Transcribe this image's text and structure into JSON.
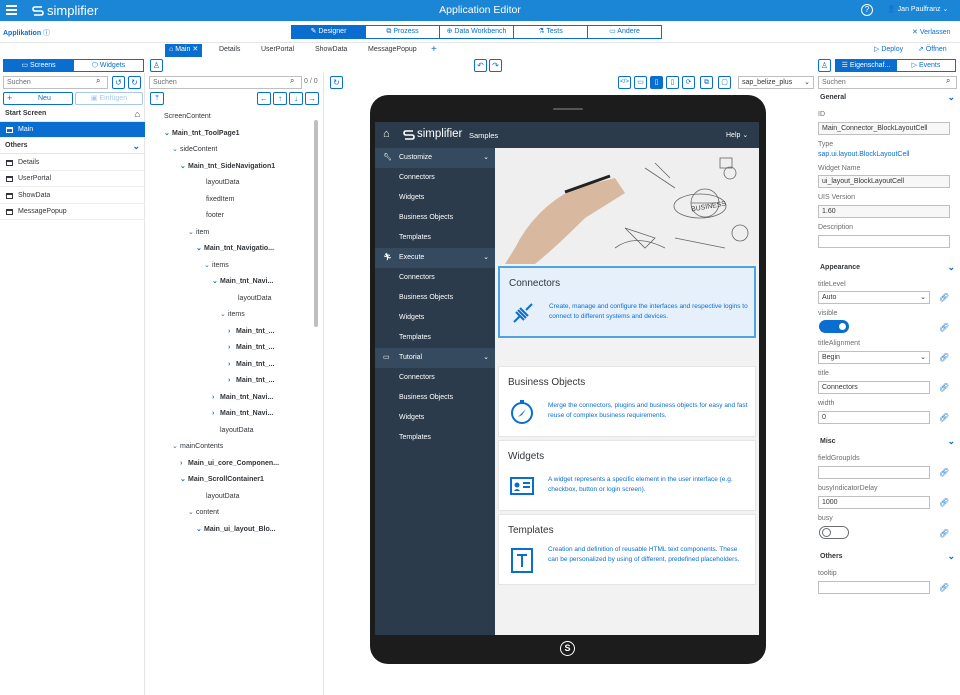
{
  "topbar": {
    "brand": "simplifier",
    "title": "Application Editor",
    "help": "?",
    "user": "Jan Paulfranz"
  },
  "bar2": {
    "app_label": "Applikation",
    "modes": [
      "Designer",
      "Prozess",
      "Data Workbench",
      "Tests",
      "Andere"
    ],
    "leave": "Verlassen"
  },
  "tabs": {
    "items": [
      "Main",
      "Details",
      "UserPortal",
      "ShowData",
      "MessagePopup"
    ],
    "add": "+",
    "deploy": "Deploy",
    "open": "Öffnen"
  },
  "left": {
    "seg_screens": "Screens",
    "seg_widgets": "Widgets",
    "search_placeholder": "Suchen",
    "new_label": "Neu",
    "paste_label": "Einfügen",
    "start_header": "Start Screen",
    "start_items": [
      "Main"
    ],
    "others_header": "Others",
    "others_items": [
      "Details",
      "UserPortal",
      "ShowData",
      "MessagePopup"
    ]
  },
  "tree": {
    "search_placeholder": "Suchen",
    "count": "0 / 0",
    "nodes": [
      {
        "label": "ScreenContent",
        "chev": ""
      },
      {
        "label": "Main_tnt_ToolPage1",
        "chev": "⌄",
        "bold": true
      },
      {
        "label": "sideContent",
        "chev": "⌄"
      },
      {
        "label": "Main_tnt_SideNavigation1",
        "chev": "⌄",
        "bold": true
      },
      {
        "label": "layoutData",
        "chev": ""
      },
      {
        "label": "fixedItem",
        "chev": ""
      },
      {
        "label": "footer",
        "chev": ""
      },
      {
        "label": "item",
        "chev": "⌄"
      },
      {
        "label": "Main_tnt_Navigatio...",
        "chev": "⌄",
        "bold": true
      },
      {
        "label": "items",
        "chev": "⌄"
      },
      {
        "label": "Main_tnt_Navi...",
        "chev": "⌄",
        "bold": true
      },
      {
        "label": "layoutData",
        "chev": ""
      },
      {
        "label": "items",
        "chev": "⌄"
      },
      {
        "label": "Main_tnt_...",
        "chev": "›",
        "bold": true
      },
      {
        "label": "Main_tnt_...",
        "chev": "›",
        "bold": true
      },
      {
        "label": "Main_tnt_...",
        "chev": "›",
        "bold": true
      },
      {
        "label": "Main_tnt_...",
        "chev": "›",
        "bold": true
      },
      {
        "label": "Main_tnt_Navi...",
        "chev": "›",
        "bold": true
      },
      {
        "label": "Main_tnt_Navi...",
        "chev": "›",
        "bold": true
      },
      {
        "label": "layoutData",
        "chev": ""
      },
      {
        "label": "mainContents",
        "chev": "⌄"
      },
      {
        "label": "Main_ui_core_Componen...",
        "chev": "›",
        "bold": true
      },
      {
        "label": "Main_ScrollContainer1",
        "chev": "⌄",
        "bold": true
      },
      {
        "label": "layoutData",
        "chev": ""
      },
      {
        "label": "content",
        "chev": "⌄"
      },
      {
        "label": "Main_ui_layout_Blo...",
        "chev": "⌄",
        "bold": true
      }
    ]
  },
  "canvas": {
    "theme": "sap_belize_plus"
  },
  "app": {
    "brand": "simplifier",
    "section": "Samples",
    "help": "Help",
    "nav": [
      {
        "group": "Customize",
        "items": [
          "Connectors",
          "Widgets",
          "Business Objects",
          "Templates"
        ]
      },
      {
        "group": "Execute",
        "items": [
          "Connectors",
          "Business Objects",
          "Widgets",
          "Templates"
        ]
      },
      {
        "group": "Tutorial",
        "items": [
          "Connectors",
          "Business Objects",
          "Widgets",
          "Templates"
        ]
      }
    ],
    "cards": [
      {
        "title": "Connectors",
        "desc": "Create, manage and configure the interfaces and respective logins to connect to different systems and devices."
      },
      {
        "title": "Business Objects",
        "desc": "Merge the connectors, plugins and business objects for easy and fast reuse of complex business requirements."
      },
      {
        "title": "Widgets",
        "desc": "A widget represents a specific element in the user interface (e.g. checkbox, button or login screen)."
      },
      {
        "title": "Templates",
        "desc": "Creation and definition of reusable HTML text components. These can be personalized by using of different, predefined placeholders."
      }
    ]
  },
  "props": {
    "seg_props": "Eigenschaf...",
    "seg_events": "Events",
    "search_placeholder": "Suchen",
    "general": "General",
    "id_label": "ID",
    "id_value": "Main_Connector_BlockLayoutCell",
    "type_label": "Type",
    "type_value": "sap.ui.layout.BlockLayoutCell",
    "wname_label": "Widget Name",
    "wname_value": "ui_layout_BlockLayoutCell",
    "uis_label": "UIS Version",
    "uis_value": "1.60",
    "desc_label": "Description",
    "desc_value": "",
    "appearance": "Appearance",
    "titlelevel_label": "titleLevel",
    "titlelevel_value": "Auto",
    "visible_label": "visible",
    "visible_value": true,
    "titlealign_label": "titleAlignment",
    "titlealign_value": "Begin",
    "title_label": "title",
    "title_value": "Connectors",
    "width_label": "width",
    "width_value": "0",
    "misc": "Misc",
    "fieldgroup_label": "fieldGroupIds",
    "fieldgroup_value": "",
    "busydelay_label": "busyIndicatorDelay",
    "busydelay_value": "1000",
    "busy_label": "busy",
    "busy_value": false,
    "others": "Others",
    "tooltip_label": "tooltip",
    "tooltip_value": ""
  }
}
